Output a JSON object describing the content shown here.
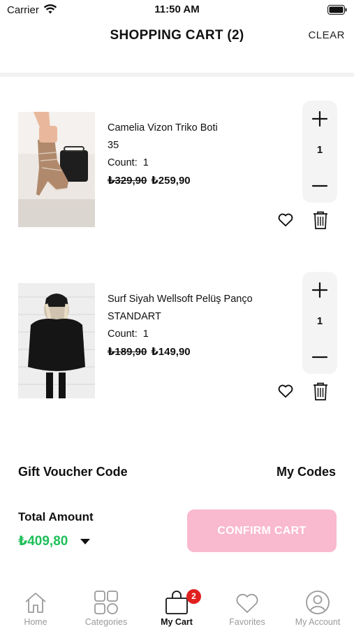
{
  "status_bar": {
    "carrier": "Carrier",
    "time": "11:50 AM"
  },
  "header": {
    "title": "SHOPPING CART (2)",
    "clear_label": "CLEAR"
  },
  "items": [
    {
      "name": "Camelia Vizon Triko Boti",
      "variant": "35",
      "count_label": "Count:",
      "count": "1",
      "old_price": "₺329,90",
      "price": "₺259,90",
      "quantity": "1",
      "image_icon": "knit-boot-photo"
    },
    {
      "name": "Surf Siyah Wellsoft Pelüş Panço",
      "variant": "STANDART",
      "count_label": "Count:",
      "count": "1",
      "old_price": "₺189,90",
      "price": "₺149,90",
      "quantity": "1",
      "image_icon": "black-poncho-photo"
    }
  ],
  "voucher": {
    "label": "Gift Voucher Code",
    "my_codes": "My Codes"
  },
  "total": {
    "label": "Total Amount",
    "amount": "₺409,80"
  },
  "confirm_label": "CONFIRM CART",
  "tabs": [
    {
      "label": "Home",
      "icon": "home-icon"
    },
    {
      "label": "Categories",
      "icon": "grid-icon"
    },
    {
      "label": "My Cart",
      "icon": "bag-icon",
      "badge": "2",
      "active": true
    },
    {
      "label": "Favorites",
      "icon": "heart-icon"
    },
    {
      "label": "My Account",
      "icon": "user-icon"
    }
  ],
  "colors": {
    "accent_green": "#1fbf5a",
    "confirm_disabled": "#f9b9cf",
    "badge_red": "#e0201f"
  }
}
